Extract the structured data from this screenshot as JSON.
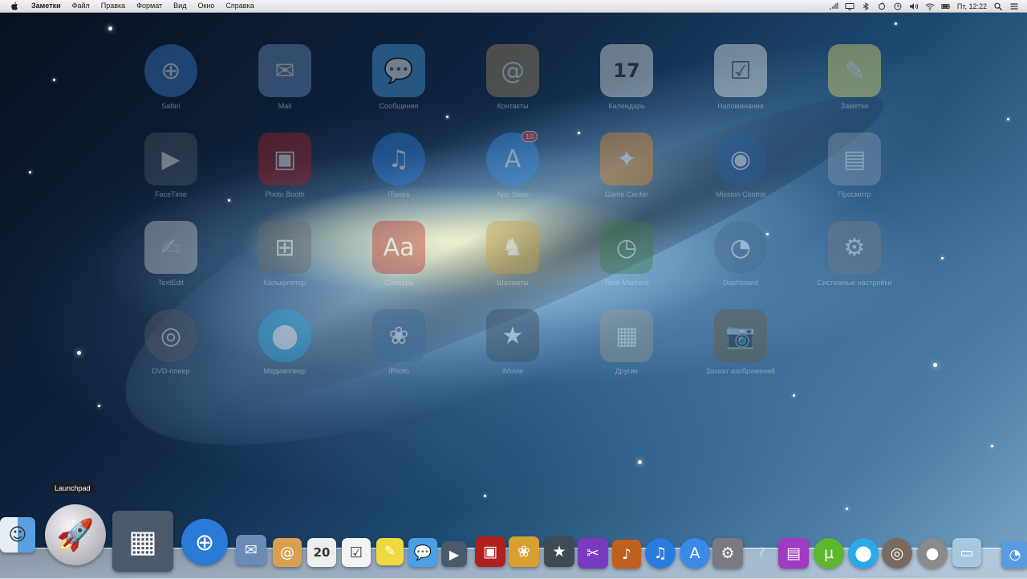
{
  "menubar": {
    "app_name": "Заметки",
    "items": [
      "Файл",
      "Правка",
      "Формат",
      "Вид",
      "Окно",
      "Справка"
    ],
    "clock": "Пт, 12:22"
  },
  "launchpad": {
    "apps": [
      {
        "name": "safari",
        "label": "Safari",
        "icon": "compass-icon",
        "color": "#3b7fd0",
        "glyph": "⊕"
      },
      {
        "name": "mail",
        "label": "Mail",
        "icon": "stamp-icon",
        "color": "#6c8ec0",
        "glyph": "✉"
      },
      {
        "name": "messages",
        "label": "Сообщения",
        "icon": "speech-bubble-icon",
        "color": "#4aa3e8",
        "glyph": "💬"
      },
      {
        "name": "contacts",
        "label": "Контакты",
        "icon": "address-book-icon",
        "color": "#a08a62",
        "glyph": "@"
      },
      {
        "name": "calendar",
        "label": "Календарь",
        "icon": "calendar-icon",
        "color": "#e8e8e8",
        "glyph": "17"
      },
      {
        "name": "reminders",
        "label": "Напоминания",
        "icon": "checklist-icon",
        "color": "#f2f2f2",
        "glyph": "☑"
      },
      {
        "name": "notes",
        "label": "Заметки",
        "icon": "notepad-icon",
        "color": "#e9dc6a",
        "glyph": "✎"
      },
      {
        "name": "facetime",
        "label": "FaceTime",
        "icon": "video-camera-icon",
        "color": "#4a5a6a",
        "glyph": "▶"
      },
      {
        "name": "photo-booth",
        "label": "Photo Booth",
        "icon": "photo-booth-icon",
        "color": "#a82020",
        "glyph": "▣"
      },
      {
        "name": "itunes",
        "label": "iTunes",
        "icon": "music-note-icon",
        "color": "#2a7fe0",
        "glyph": "♫"
      },
      {
        "name": "app-store",
        "label": "App Store",
        "icon": "app-store-icon",
        "color": "#3a8fe8",
        "glyph": "A",
        "badge": "10"
      },
      {
        "name": "game-center",
        "label": "Game Center",
        "icon": "game-balloons-icon",
        "color": "#e88a2a",
        "glyph": "✦"
      },
      {
        "name": "mission-control",
        "label": "Mission Control",
        "icon": "globe-icon",
        "color": "#2a5fa0",
        "glyph": "◉"
      },
      {
        "name": "preview",
        "label": "Просмотр",
        "icon": "photos-icon",
        "color": "#8a9ab0",
        "glyph": "▤"
      },
      {
        "name": "textedit",
        "label": "TextEdit",
        "icon": "document-pen-icon",
        "color": "#c8c8c8",
        "glyph": "✍"
      },
      {
        "name": "calculator",
        "label": "Калькулятор",
        "icon": "calculator-icon",
        "color": "#6a6a6a",
        "glyph": "⊞"
      },
      {
        "name": "dictionary",
        "label": "Словарь",
        "icon": "dictionary-icon",
        "color": "#c0302a",
        "glyph": "Aa"
      },
      {
        "name": "chess",
        "label": "Шахматы",
        "icon": "chess-icon",
        "color": "#c8a040",
        "glyph": "♞"
      },
      {
        "name": "time-machine",
        "label": "Time Machine",
        "icon": "clock-icon",
        "color": "#3a7a4a",
        "glyph": "◷"
      },
      {
        "name": "dashboard",
        "label": "Dashboard",
        "icon": "gauge-icon",
        "color": "#4a6a8a",
        "glyph": "◔"
      },
      {
        "name": "system-preferences",
        "label": "Системные настройки",
        "icon": "gear-icon",
        "color": "#7a7a82",
        "glyph": "⚙"
      },
      {
        "name": "dvd-player",
        "label": "DVD-плеер",
        "icon": "speaker-icon",
        "color": "#5a5a60",
        "glyph": "◎"
      },
      {
        "name": "media-player",
        "label": "Медиаплеер",
        "icon": "film-reel-icon",
        "color": "#2aa8e0",
        "glyph": "⬤"
      },
      {
        "name": "iphoto",
        "label": "iPhoto",
        "icon": "iphoto-icon",
        "color": "#3a6a9a",
        "glyph": "❀"
      },
      {
        "name": "imovie",
        "label": "iMovie",
        "icon": "star-icon",
        "color": "#3a4a5a",
        "glyph": "★"
      },
      {
        "name": "utilities",
        "label": "Другие",
        "icon": "folder-icon",
        "color": "#9a9a8a",
        "glyph": "▦"
      },
      {
        "name": "image-capture",
        "label": "Захват изображений",
        "icon": "camera-icon",
        "color": "#6a5a3a",
        "glyph": "📷"
      }
    ]
  },
  "dock": {
    "tooltip": "Launchpad",
    "items": [
      {
        "name": "finder",
        "icon": "finder-icon",
        "color": "#5aa0e0",
        "glyph": "☺"
      },
      {
        "name": "launchpad",
        "icon": "rocket-icon",
        "color": "#c8c8cc",
        "glyph": "🚀"
      },
      {
        "name": "mission-control",
        "icon": "mission-control-icon",
        "color": "#4a5a6a",
        "glyph": "▦"
      },
      {
        "name": "safari",
        "icon": "compass-icon",
        "color": "#2a7ad8",
        "glyph": "⊕"
      },
      {
        "name": "mail",
        "icon": "stamp-icon",
        "color": "#6a8ab8",
        "glyph": "✉"
      },
      {
        "name": "contacts",
        "icon": "address-book-icon",
        "color": "#d8a050",
        "glyph": "@"
      },
      {
        "name": "calendar",
        "icon": "calendar-icon",
        "color": "#eeeeee",
        "glyph": "20"
      },
      {
        "name": "reminders",
        "icon": "checklist-icon",
        "color": "#f4f4f4",
        "glyph": "☑"
      },
      {
        "name": "notes",
        "icon": "notepad-icon",
        "color": "#f0d840",
        "glyph": "✎"
      },
      {
        "name": "messages",
        "icon": "speech-bubble-icon",
        "color": "#4aa0e8",
        "glyph": "💬"
      },
      {
        "name": "facetime",
        "icon": "video-camera-icon",
        "color": "#4a5a6a",
        "glyph": "▶"
      },
      {
        "name": "photo-booth",
        "icon": "photo-booth-icon",
        "color": "#b02020",
        "glyph": "▣"
      },
      {
        "name": "iphoto",
        "icon": "iphoto-icon",
        "color": "#d8a030",
        "glyph": "❀"
      },
      {
        "name": "imovie",
        "icon": "star-icon",
        "color": "#404a52",
        "glyph": "★"
      },
      {
        "name": "final-cut",
        "icon": "clapperboard-icon",
        "color": "#7a3ac0",
        "glyph": "✂"
      },
      {
        "name": "garageband",
        "icon": "guitar-icon",
        "color": "#c06020",
        "glyph": "♪"
      },
      {
        "name": "itunes",
        "icon": "music-note-icon",
        "color": "#2a7ae0",
        "glyph": "♫"
      },
      {
        "name": "app-store",
        "icon": "app-store-icon",
        "color": "#3a8ae8",
        "glyph": "A"
      },
      {
        "name": "system-preferences",
        "icon": "gear-icon",
        "color": "#7a7a82",
        "glyph": "⚙"
      },
      {
        "name": "help",
        "icon": "question-mark-icon",
        "color": "#9a9aa0",
        "glyph": "?"
      },
      {
        "name": "photo-slideshow",
        "icon": "slideshow-icon",
        "color": "#a03ac0",
        "glyph": "▤"
      },
      {
        "name": "utorrent",
        "icon": "utorrent-icon",
        "color": "#5ab82a",
        "glyph": "µ"
      },
      {
        "name": "media-player",
        "icon": "film-reel-icon",
        "color": "#2aa8e8",
        "glyph": "⬤"
      },
      {
        "name": "dvd-player",
        "icon": "speaker-icon",
        "color": "#7a6a60",
        "glyph": "◎"
      },
      {
        "name": "media-record",
        "icon": "record-icon",
        "color": "#8a8a8a",
        "glyph": "●"
      },
      {
        "name": "preview",
        "icon": "picture-icon",
        "color": "#a8c8e0",
        "glyph": "▭"
      },
      {
        "name": "downloads",
        "icon": "downloads-stack-icon",
        "color": "#5a9ae0",
        "glyph": "◔"
      }
    ]
  }
}
